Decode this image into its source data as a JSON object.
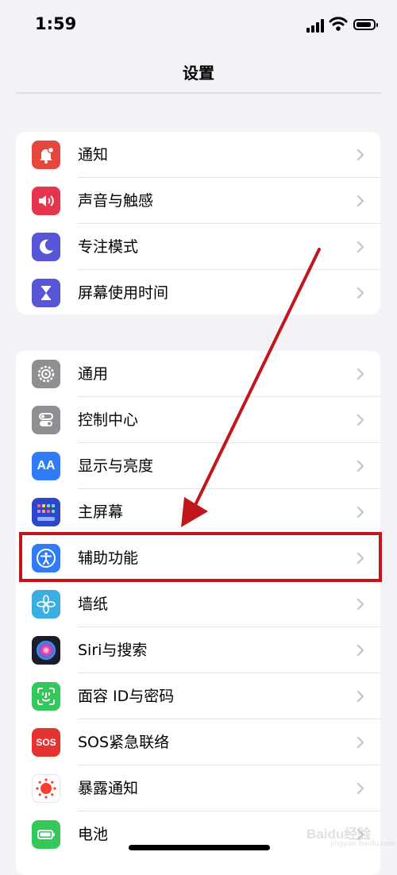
{
  "status_bar": {
    "time": "1:59"
  },
  "nav": {
    "title": "设置"
  },
  "groups": [
    {
      "items": [
        {
          "label": "通知",
          "icon": "notifications-icon",
          "color": "#e5473e"
        },
        {
          "label": "声音与触感",
          "icon": "sound-icon",
          "color": "#e5344e"
        },
        {
          "label": "专注模式",
          "icon": "moon-icon",
          "color": "#5856d6"
        },
        {
          "label": "屏幕使用时间",
          "icon": "hourglass-icon",
          "color": "#5856d6"
        }
      ]
    },
    {
      "items": [
        {
          "label": "通用",
          "icon": "gear-icon",
          "color": "#8e8e93"
        },
        {
          "label": "控制中心",
          "icon": "toggles-icon",
          "color": "#8e8e93"
        },
        {
          "label": "显示与亮度",
          "icon": "aa-icon",
          "color": "#2f7cf6"
        },
        {
          "label": "主屏幕",
          "icon": "home-grid-icon",
          "color": "#2c47c9"
        },
        {
          "label": "辅助功能",
          "icon": "accessibility-icon",
          "color": "#2f7cf6"
        },
        {
          "label": "墙纸",
          "icon": "flower-icon",
          "color": "#3aaee0"
        },
        {
          "label": "Siri与搜索",
          "icon": "siri-icon",
          "color": "#1c1c2e"
        },
        {
          "label": "面容 ID与密码",
          "icon": "face-id-icon",
          "color": "#34c759"
        },
        {
          "label": "SOS紧急联络",
          "icon": "sos-icon",
          "color": "#e5342f"
        },
        {
          "label": "暴露通知",
          "icon": "exposure-icon",
          "color": "#ffffff"
        },
        {
          "label": "电池",
          "icon": "battery-icon",
          "color": "#34c759"
        }
      ]
    }
  ],
  "icon_text": {
    "aa": "AA",
    "sos": "SOS"
  },
  "annotation": {
    "color": "#c0171d"
  },
  "watermark": {
    "text": "Baidu经验",
    "sub": "jingyan.baidu.com"
  }
}
